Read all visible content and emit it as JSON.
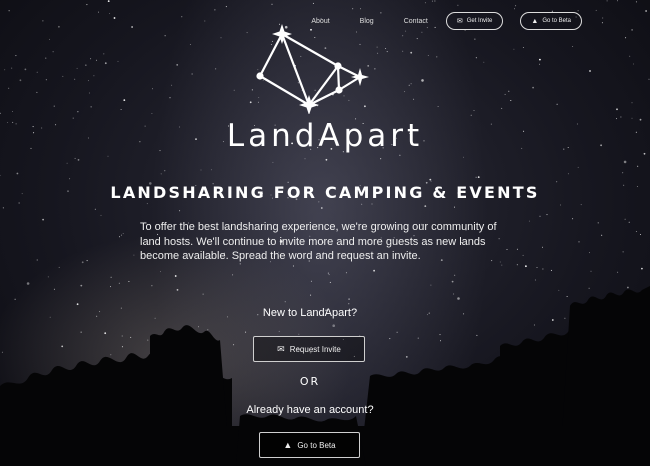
{
  "nav": {
    "links": [
      "About",
      "Blog",
      "Contact"
    ],
    "get_invite": {
      "label": "Get Invite",
      "icon": "envelope-icon"
    },
    "go_to_beta": {
      "label": "Go to Beta",
      "icon": "flask-icon"
    }
  },
  "brand": {
    "name": "LandApart",
    "logo": "constellation-logo"
  },
  "hero": {
    "tagline": "LANDSHARING FOR CAMPING & EVENTS",
    "intro": "To offer the best landsharing experience, we're growing our community of land hosts. We'll continue to invite more and more guests as new lands become available. Spread the word and request an invite.",
    "new_prompt": "New to LandApart?",
    "request_invite": {
      "label": "Request Invite",
      "icon": "envelope-icon"
    },
    "or": "OR",
    "existing_prompt": "Already have an account?",
    "go_to_beta": {
      "label": "Go to Beta",
      "icon": "flask-icon"
    }
  }
}
